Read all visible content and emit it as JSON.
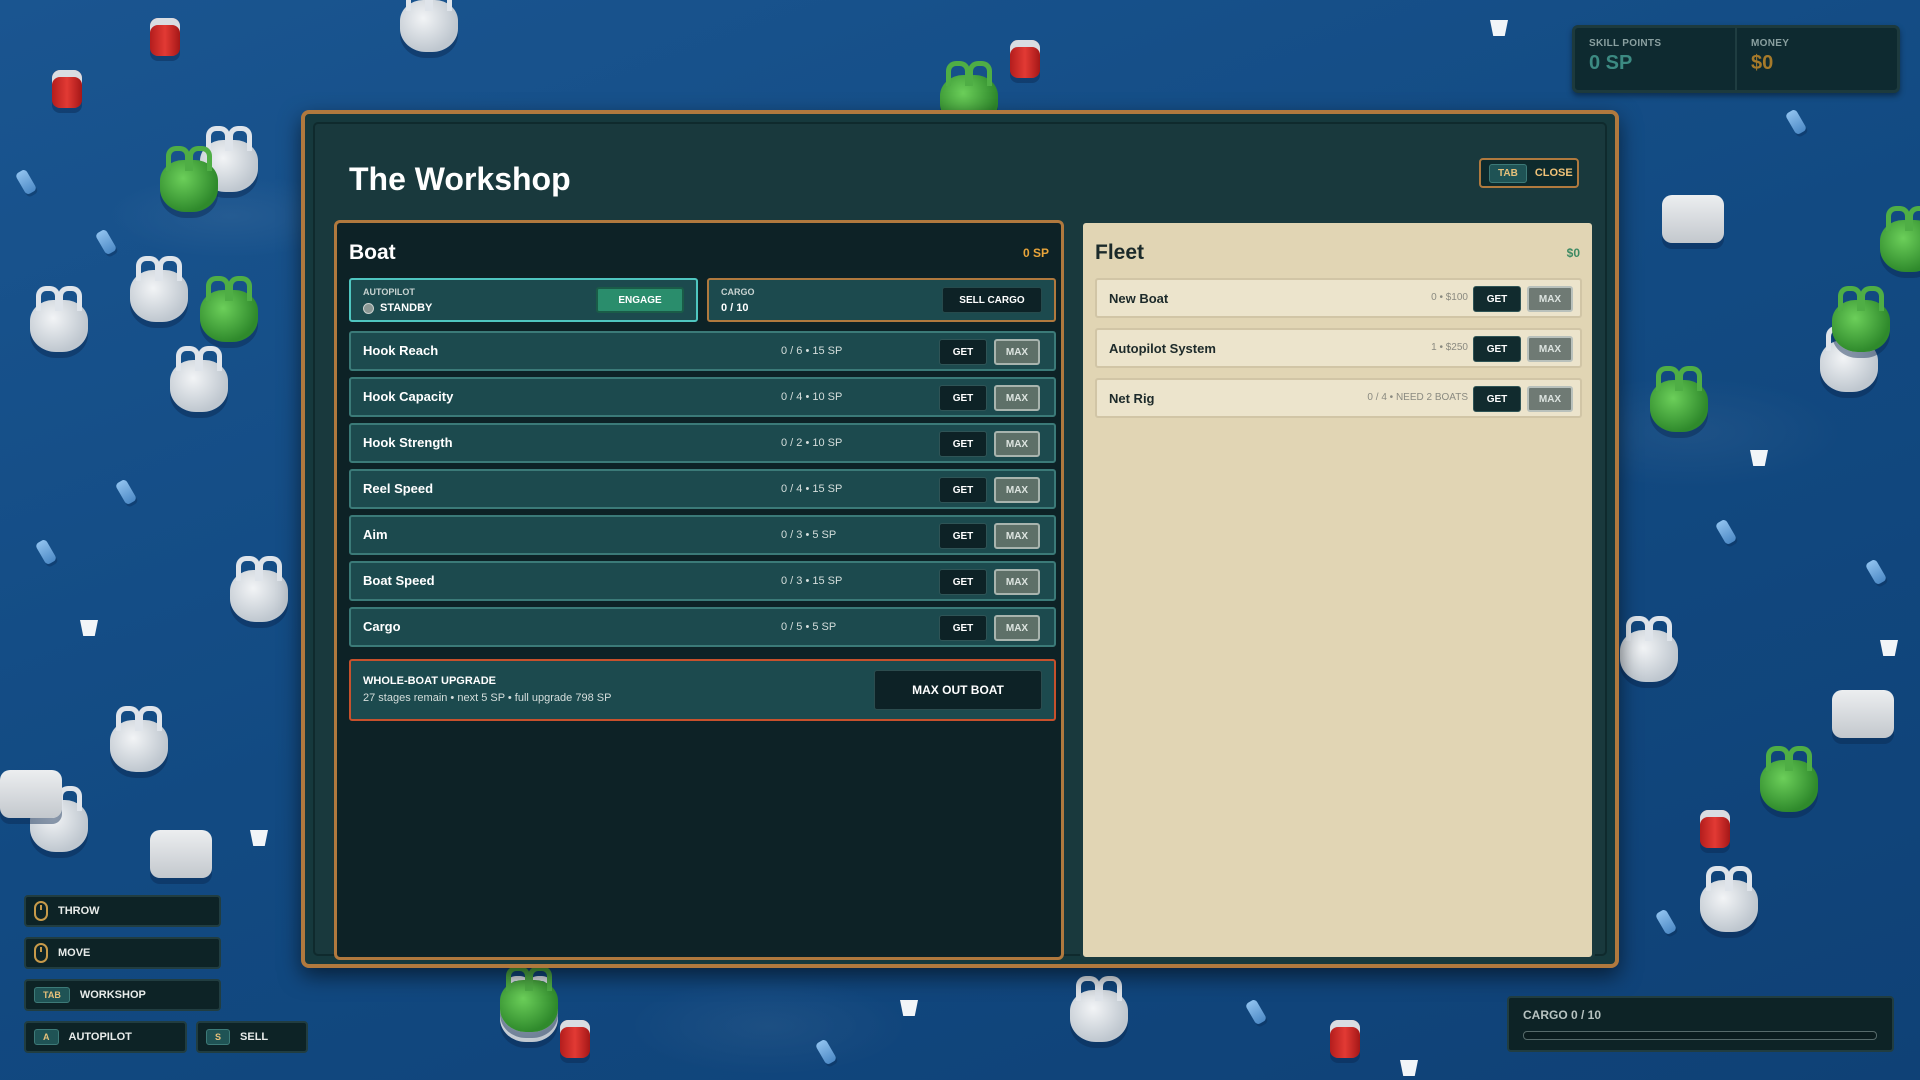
{
  "hud": {
    "skill_points_label": "SKILL POINTS",
    "skill_points_value": "0 SP",
    "money_label": "MONEY",
    "money_value": "$0"
  },
  "workshop": {
    "title": "The Workshop",
    "close_key": "TAB",
    "close_label": "CLOSE"
  },
  "boat": {
    "title": "Boat",
    "points": "0 SP",
    "autopilot": {
      "label": "AUTOPILOT",
      "status": "STANDBY",
      "button": "ENGAGE"
    },
    "cargo": {
      "label": "CARGO",
      "value": "0 / 10",
      "button": "SELL CARGO"
    },
    "get_label": "GET",
    "max_label": "MAX",
    "upgrades": [
      {
        "name": "Hook Reach",
        "meta": "0 / 6  •  15 SP"
      },
      {
        "name": "Hook Capacity",
        "meta": "0 / 4  •  10 SP"
      },
      {
        "name": "Hook Strength",
        "meta": "0 / 2  •  10 SP"
      },
      {
        "name": "Reel Speed",
        "meta": "0 / 4  •  15 SP"
      },
      {
        "name": "Aim",
        "meta": "0 / 3  •  5 SP"
      },
      {
        "name": "Boat Speed",
        "meta": "0 / 3  •  15 SP"
      },
      {
        "name": "Cargo",
        "meta": "0 / 5  •  5 SP"
      }
    ],
    "whole_upgrade": {
      "title": "WHOLE-BOAT UPGRADE",
      "subtitle": "27 stages remain  •  next 5 SP  •  full upgrade 798 SP",
      "button": "MAX OUT BOAT"
    }
  },
  "fleet": {
    "title": "Fleet",
    "money": "$0",
    "get_label": "GET",
    "max_label": "MAX",
    "items": [
      {
        "name": "New Boat",
        "meta": "0  •  $100"
      },
      {
        "name": "Autopilot System",
        "meta": "1  •  $250"
      },
      {
        "name": "Net Rig",
        "meta": "0 / 4  •  NEED 2 BOATS"
      }
    ]
  },
  "controls": {
    "throw": "THROW",
    "move": "MOVE",
    "workshop_key": "TAB",
    "workshop": "WORKSHOP",
    "autopilot_key": "A",
    "autopilot": "AUTOPILOT",
    "sell_key": "S",
    "sell": "SELL"
  },
  "cargo_hud": {
    "label": "CARGO  0 / 10",
    "fill_fraction": 0
  },
  "colors": {
    "accent": "#b0793e",
    "teal": "#3c8a82",
    "engage": "#2a8d6c",
    "warning": "#c7512c"
  }
}
